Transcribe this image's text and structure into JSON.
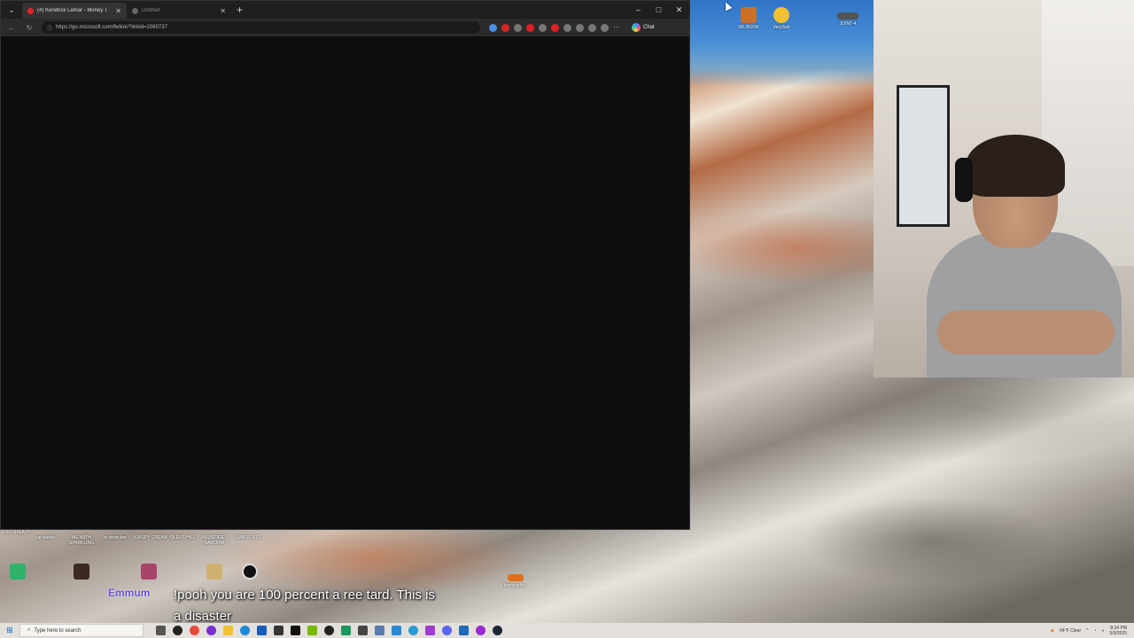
{
  "browser": {
    "tabs": [
      {
        "title": "(4) Kendrick Lamar - Money T",
        "active": true
      },
      {
        "title": "Untitled",
        "active": false
      }
    ],
    "new_tab_symbol": "+",
    "window_controls": {
      "minimize": "–",
      "maximize": "□",
      "close": "✕"
    },
    "url": "https://go.microsoft.com/fwlink/?linkid=2080737",
    "chat_label": "Chat"
  },
  "desktop_icons": [
    {
      "label": "IRL BOOK",
      "color": "#c9702a"
    },
    {
      "label": "VerySub",
      "color": "#f2c12e"
    },
    {
      "label": "JOINT-4",
      "color": "#555555"
    },
    {
      "label": "GOG GALAXY",
      "color": "#6c2fb3"
    },
    {
      "label": "cat-dance-...",
      "color": "#b49a6a"
    },
    {
      "label": "ME WITH SPARKLING",
      "color": "#7a5a3a"
    },
    {
      "label": "w forsticker",
      "color": "#8a8a8a"
    },
    {
      "label": "KRISPY CREAM",
      "color": "#c93c3c"
    },
    {
      "label": "SILENT HILL",
      "color": "#5a5a5a"
    },
    {
      "label": "INJUSTICE 2 SAMURAI",
      "color": "#3a3a6a"
    },
    {
      "label": "LMAO CATS",
      "color": "#a08060"
    },
    {
      "label": "burning-fir...",
      "color": "#e0701a"
    }
  ],
  "chat": {
    "username": "Emmum",
    "message": "!pooh you are 100 percent a ree tard. This is a disaster"
  },
  "taskbar": {
    "search_placeholder": "Type here to search",
    "weather": "64°F Clear",
    "time": "8:34 PM",
    "date": "5/9/2025"
  },
  "colors": {
    "browser_bg": "#0e0e0e",
    "tab_active": "#333333",
    "taskbar_bg": "#e4e0dc"
  }
}
